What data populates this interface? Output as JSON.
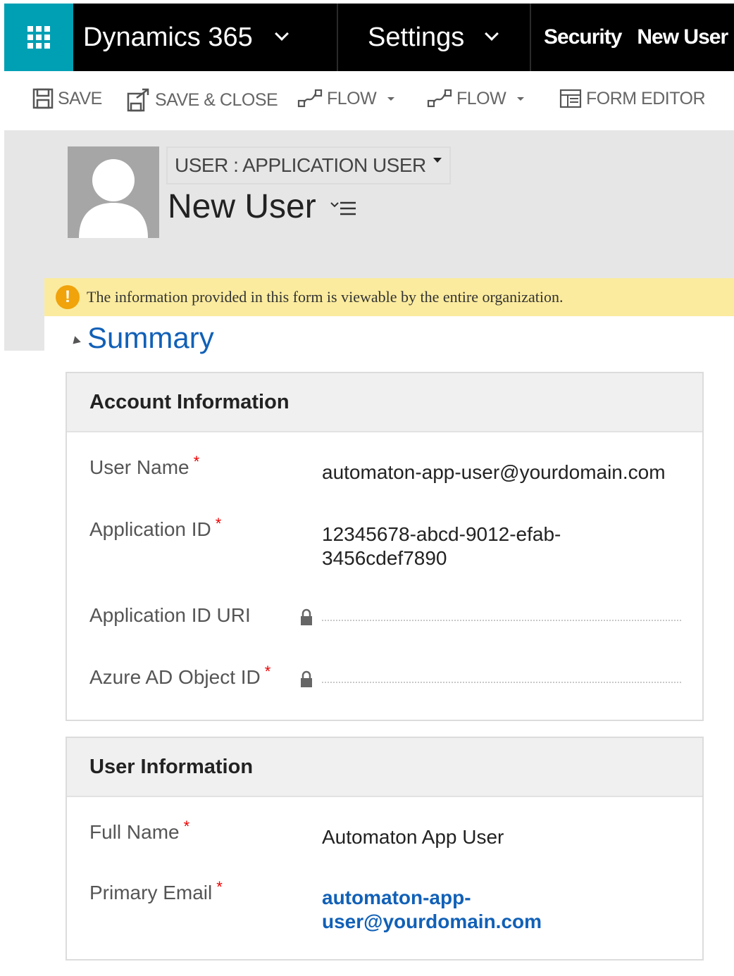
{
  "nav": {
    "app_name": "Dynamics 365",
    "area_name": "Settings",
    "breadcrumb_1": "Security",
    "breadcrumb_2": "New User",
    "colors": {
      "bar": "#000000",
      "waffle": "#00a0b4"
    }
  },
  "commands": {
    "save": "SAVE",
    "save_close": "SAVE & CLOSE",
    "flow_1": "FLOW",
    "flow_2": "FLOW",
    "form_editor": "FORM EDITOR"
  },
  "header": {
    "form_selector": "USER : APPLICATION USER",
    "record_title": "New User"
  },
  "notification": {
    "icon": "!",
    "text": "The information provided in this form is viewable by the entire organization."
  },
  "summary": {
    "title": "Summary"
  },
  "account_info": {
    "title": "Account Information",
    "required_marker": "*",
    "user_name_label": "User Name",
    "user_name_value": "automaton-app-user@yourdomain.com",
    "application_id_label": "Application ID",
    "application_id_value_line1": "12345678-abcd-9012-efab-",
    "application_id_value_line2": "3456cdef7890",
    "application_id_uri_label": "Application ID URI",
    "azure_ad_object_id_label": "Azure AD Object ID"
  },
  "user_info": {
    "title": "User Information",
    "full_name_label": "Full Name",
    "full_name_value": "Automaton App User",
    "primary_email_label": "Primary Email",
    "primary_email_line1": "automaton-app-",
    "primary_email_line2": "user@yourdomain.com"
  }
}
